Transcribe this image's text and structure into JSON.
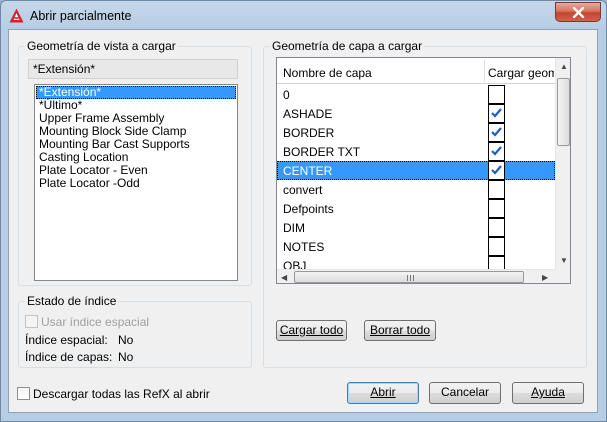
{
  "window": {
    "title": "Abrir parcialmente"
  },
  "view_group": {
    "label": "Geometría de vista a cargar",
    "selected_view": "*Extensión*",
    "views": [
      "*Extensión*",
      "*Último*",
      "Upper Frame Assembly",
      "Mounting Block Side Clamp",
      "Mounting Bar Cast Supports",
      "Casting Location",
      "Plate Locator - Even",
      "Plate Locator -Odd"
    ]
  },
  "index_group": {
    "label": "Estado de índice",
    "spatial_index_checkbox_label": "Usar índice espacial",
    "spatial_index_label": "Índice espacial:",
    "spatial_index_value": "No",
    "layer_index_label": "Índice de capas:",
    "layer_index_value": "No"
  },
  "layer_group": {
    "label": "Geometría de capa a cargar",
    "columns": [
      "Nombre de capa",
      "Cargar geometría"
    ],
    "selected_layer": "CENTER",
    "layers": [
      {
        "name": "0",
        "checked": false
      },
      {
        "name": "ASHADE",
        "checked": true
      },
      {
        "name": "BORDER",
        "checked": true
      },
      {
        "name": "BORDER TXT",
        "checked": true
      },
      {
        "name": "CENTER",
        "checked": true
      },
      {
        "name": "convert",
        "checked": false
      },
      {
        "name": "Defpoints",
        "checked": false
      },
      {
        "name": "DIM",
        "checked": false
      },
      {
        "name": "NOTES",
        "checked": false
      },
      {
        "name": "OBJ",
        "checked": false
      }
    ],
    "load_all_label": "Cargar todo",
    "clear_all_label": "Borrar todo"
  },
  "footer": {
    "unload_xrefs_label": "Descargar todas las RefX al abrir",
    "open_label": "Abrir",
    "cancel_label": "Cancelar",
    "help_label": "Ayuda"
  },
  "colors": {
    "selection": "#3399ff",
    "check": "#1f5fbf",
    "app_icon": "#d2222d"
  },
  "icons": {
    "app": "autocad-a-icon",
    "close": "close-x-icon",
    "check": "checkmark-icon"
  }
}
